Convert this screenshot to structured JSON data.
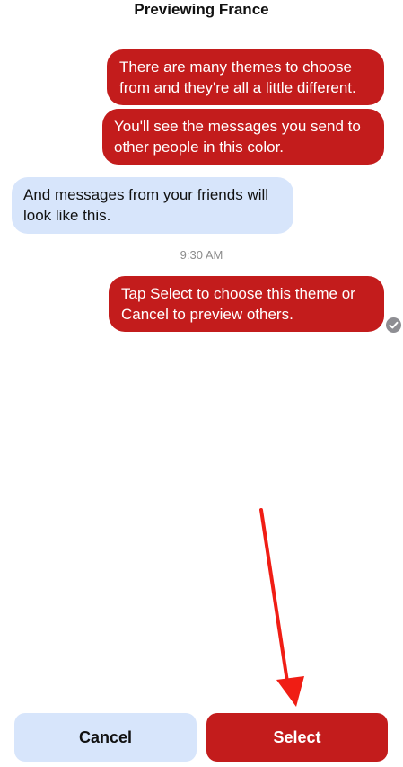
{
  "header": {
    "title": "Previewing France"
  },
  "messages": [
    {
      "direction": "outgoing",
      "lines": [
        "There are many themes to choose",
        "from and they're all a little different."
      ]
    },
    {
      "direction": "outgoing",
      "lines": [
        "You'll see the messages you send to",
        "other people in this color."
      ]
    },
    {
      "direction": "incoming",
      "lines": [
        "And messages from your friends will",
        "look like this."
      ]
    },
    {
      "direction": "outgoing",
      "lines": [
        "Tap Select to choose this theme or",
        "Cancel to preview others."
      ]
    }
  ],
  "timestamp": "9:30 AM",
  "icons": {
    "delivered": "checkmark-circle-icon",
    "annotation": "red-arrow-icon"
  },
  "buttons": {
    "cancel_label": "Cancel",
    "select_label": "Select"
  },
  "colors": {
    "theme_accent": "#c31c1c",
    "incoming_bubble": "#d7e5fb",
    "annotation_arrow": "#f01d14"
  }
}
